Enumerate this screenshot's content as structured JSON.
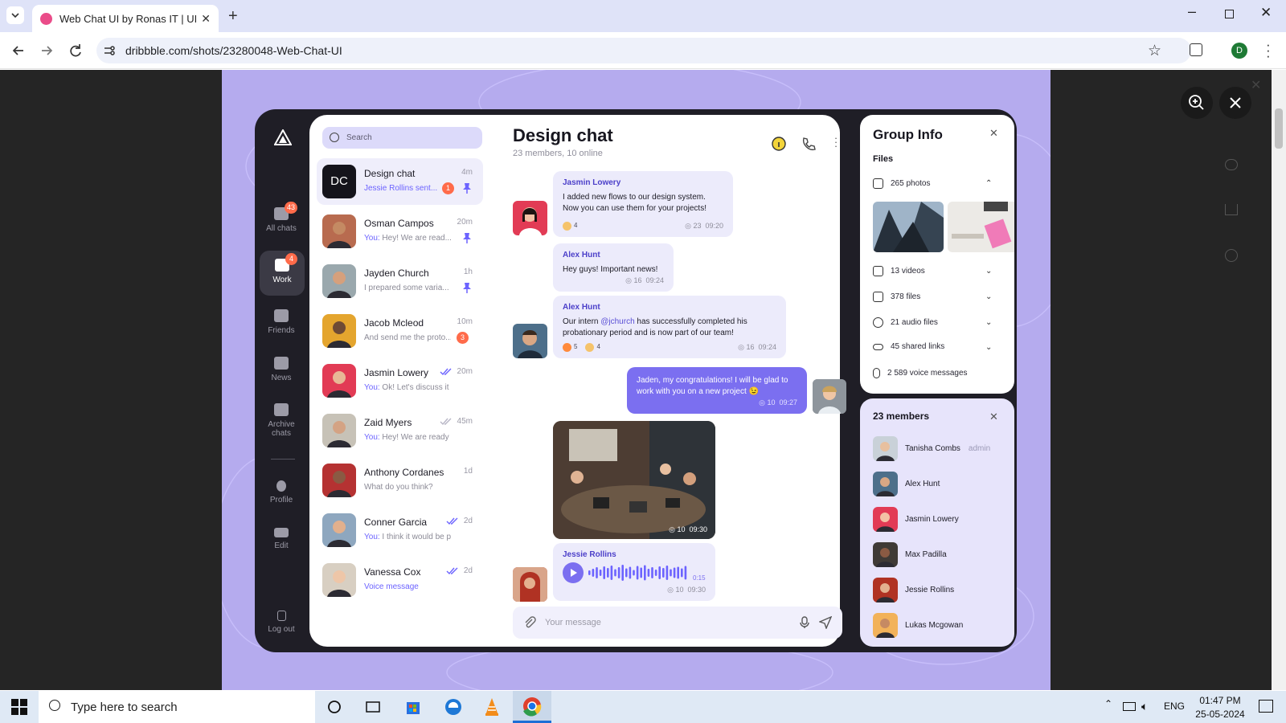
{
  "browser": {
    "tab_title": "Web Chat UI by Ronas IT | UI/U",
    "url": "dribbble.com/shots/23280048-Web-Chat-UI",
    "profile_initial": "D"
  },
  "rail": {
    "items": [
      {
        "label": "All chats",
        "badge": "43"
      },
      {
        "label": "Work",
        "badge": "4"
      },
      {
        "label": "Friends",
        "badge": ""
      },
      {
        "label": "News",
        "badge": ""
      },
      {
        "label": "Archive chats",
        "badge": ""
      },
      {
        "label": "Profile",
        "badge": ""
      },
      {
        "label": "Edit",
        "badge": ""
      },
      {
        "label": "Log out",
        "badge": ""
      }
    ]
  },
  "search": {
    "placeholder": "Search"
  },
  "chats": [
    {
      "avatar": "DC",
      "name": "Design chat",
      "time": "4m",
      "preview_you": "",
      "preview": "Jessie Rollins sent...",
      "count": "1",
      "pinned": true
    },
    {
      "name": "Osman Campos",
      "time": "20m",
      "preview_you": "You:",
      "preview": " Hey! We are read...",
      "count": "",
      "pinned": true
    },
    {
      "name": "Jayden Church",
      "time": "1h",
      "preview_you": "",
      "preview": "I prepared some varia...",
      "count": "",
      "pinned": true
    },
    {
      "name": "Jacob Mcleod",
      "time": "10m",
      "preview_you": "",
      "preview": "And send me the proto...",
      "count": "3",
      "pinned": false
    },
    {
      "name": "Jasmin Lowery",
      "time": "20m",
      "preview_you": "You:",
      "preview": " Ok! Let's discuss it on th...",
      "count": "",
      "pinned": false
    },
    {
      "name": "Zaid Myers",
      "time": "45m",
      "preview_you": "You:",
      "preview": " Hey! We are ready to in...",
      "count": "",
      "pinned": false
    },
    {
      "name": "Anthony Cordanes",
      "time": "1d",
      "preview_you": "",
      "preview": "What do you think?",
      "count": "",
      "pinned": false
    },
    {
      "name": "Conner Garcia",
      "time": "2d",
      "preview_you": "You:",
      "preview": " I think it would be perfe...",
      "count": "",
      "pinned": false
    },
    {
      "name": "Vanessa Cox",
      "time": "2d",
      "preview_you": "",
      "preview": "Voice message",
      "count": "",
      "pinned": false
    }
  ],
  "chat": {
    "title": "Design chat",
    "subtitle": "23 members, 10 online",
    "messages": [
      {
        "sender": "Jasmin Lowery",
        "text": "I added new flows to our design system. Now you can use them for your projects!",
        "views": "23",
        "time": "09:20",
        "reactions": [
          "4"
        ]
      },
      {
        "sender": "Alex Hunt",
        "text": "Hey guys! Important news!",
        "views": "16",
        "time": "09:24"
      },
      {
        "sender": "Alex Hunt",
        "text_before": "Our intern ",
        "mention": "@jchurch",
        "text_after": " has successfully completed his probationary period and is now part of our team!",
        "views": "16",
        "time": "09:24",
        "reactions": [
          "5",
          "4"
        ]
      },
      {
        "sender": "",
        "text": "Jaden, my congratulations! I will be glad to work with you on a new project 😉",
        "views": "10",
        "time": "09:27"
      },
      {
        "sender": "",
        "text": "",
        "views": "10",
        "time": "09:30"
      },
      {
        "sender": "Jessie Rollins",
        "duration": "0:15",
        "views": "10",
        "time": "09:30"
      }
    ],
    "composer_placeholder": "Your message"
  },
  "group_info": {
    "title": "Group Info",
    "files_heading": "Files",
    "files": [
      {
        "icon": "photo-icon",
        "label": "265 photos"
      },
      {
        "icon": "video-icon",
        "label": "13 videos"
      },
      {
        "icon": "file-icon",
        "label": "378 files"
      },
      {
        "icon": "music-icon",
        "label": "21 audio files"
      },
      {
        "icon": "link-icon",
        "label": "45 shared links"
      },
      {
        "icon": "mic-icon",
        "label": "2 589 voice messages"
      }
    ]
  },
  "members": {
    "title": "23 members",
    "list": [
      {
        "name": "Tanisha Combs",
        "role": "admin"
      },
      {
        "name": "Alex Hunt",
        "role": ""
      },
      {
        "name": "Jasmin Lowery",
        "role": ""
      },
      {
        "name": "Max Padilla",
        "role": ""
      },
      {
        "name": "Jessie Rollins",
        "role": ""
      },
      {
        "name": "Lukas Mcgowan",
        "role": ""
      }
    ]
  },
  "taskbar": {
    "search_placeholder": "Type here to search",
    "time": "01:47 PM",
    "date": "25-05-2024",
    "lang": "ENG"
  },
  "colors": {
    "accent": "#6c63ff",
    "badge": "#ff6b4a",
    "hero_bg": "#b5abee",
    "dark": "#1f1e26"
  }
}
